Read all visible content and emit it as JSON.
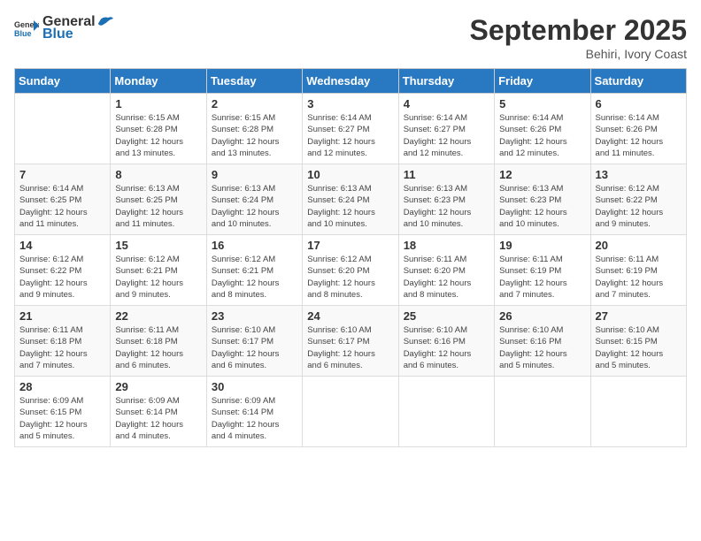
{
  "header": {
    "logo_general": "General",
    "logo_blue": "Blue",
    "month": "September 2025",
    "location": "Behiri, Ivory Coast"
  },
  "days_of_week": [
    "Sunday",
    "Monday",
    "Tuesday",
    "Wednesday",
    "Thursday",
    "Friday",
    "Saturday"
  ],
  "weeks": [
    [
      {
        "day": "",
        "info": ""
      },
      {
        "day": "1",
        "info": "Sunrise: 6:15 AM\nSunset: 6:28 PM\nDaylight: 12 hours\nand 13 minutes."
      },
      {
        "day": "2",
        "info": "Sunrise: 6:15 AM\nSunset: 6:28 PM\nDaylight: 12 hours\nand 13 minutes."
      },
      {
        "day": "3",
        "info": "Sunrise: 6:14 AM\nSunset: 6:27 PM\nDaylight: 12 hours\nand 12 minutes."
      },
      {
        "day": "4",
        "info": "Sunrise: 6:14 AM\nSunset: 6:27 PM\nDaylight: 12 hours\nand 12 minutes."
      },
      {
        "day": "5",
        "info": "Sunrise: 6:14 AM\nSunset: 6:26 PM\nDaylight: 12 hours\nand 12 minutes."
      },
      {
        "day": "6",
        "info": "Sunrise: 6:14 AM\nSunset: 6:26 PM\nDaylight: 12 hours\nand 11 minutes."
      }
    ],
    [
      {
        "day": "7",
        "info": "Sunrise: 6:14 AM\nSunset: 6:25 PM\nDaylight: 12 hours\nand 11 minutes."
      },
      {
        "day": "8",
        "info": "Sunrise: 6:13 AM\nSunset: 6:25 PM\nDaylight: 12 hours\nand 11 minutes."
      },
      {
        "day": "9",
        "info": "Sunrise: 6:13 AM\nSunset: 6:24 PM\nDaylight: 12 hours\nand 10 minutes."
      },
      {
        "day": "10",
        "info": "Sunrise: 6:13 AM\nSunset: 6:24 PM\nDaylight: 12 hours\nand 10 minutes."
      },
      {
        "day": "11",
        "info": "Sunrise: 6:13 AM\nSunset: 6:23 PM\nDaylight: 12 hours\nand 10 minutes."
      },
      {
        "day": "12",
        "info": "Sunrise: 6:13 AM\nSunset: 6:23 PM\nDaylight: 12 hours\nand 10 minutes."
      },
      {
        "day": "13",
        "info": "Sunrise: 6:12 AM\nSunset: 6:22 PM\nDaylight: 12 hours\nand 9 minutes."
      }
    ],
    [
      {
        "day": "14",
        "info": "Sunrise: 6:12 AM\nSunset: 6:22 PM\nDaylight: 12 hours\nand 9 minutes."
      },
      {
        "day": "15",
        "info": "Sunrise: 6:12 AM\nSunset: 6:21 PM\nDaylight: 12 hours\nand 9 minutes."
      },
      {
        "day": "16",
        "info": "Sunrise: 6:12 AM\nSunset: 6:21 PM\nDaylight: 12 hours\nand 8 minutes."
      },
      {
        "day": "17",
        "info": "Sunrise: 6:12 AM\nSunset: 6:20 PM\nDaylight: 12 hours\nand 8 minutes."
      },
      {
        "day": "18",
        "info": "Sunrise: 6:11 AM\nSunset: 6:20 PM\nDaylight: 12 hours\nand 8 minutes."
      },
      {
        "day": "19",
        "info": "Sunrise: 6:11 AM\nSunset: 6:19 PM\nDaylight: 12 hours\nand 7 minutes."
      },
      {
        "day": "20",
        "info": "Sunrise: 6:11 AM\nSunset: 6:19 PM\nDaylight: 12 hours\nand 7 minutes."
      }
    ],
    [
      {
        "day": "21",
        "info": "Sunrise: 6:11 AM\nSunset: 6:18 PM\nDaylight: 12 hours\nand 7 minutes."
      },
      {
        "day": "22",
        "info": "Sunrise: 6:11 AM\nSunset: 6:18 PM\nDaylight: 12 hours\nand 6 minutes."
      },
      {
        "day": "23",
        "info": "Sunrise: 6:10 AM\nSunset: 6:17 PM\nDaylight: 12 hours\nand 6 minutes."
      },
      {
        "day": "24",
        "info": "Sunrise: 6:10 AM\nSunset: 6:17 PM\nDaylight: 12 hours\nand 6 minutes."
      },
      {
        "day": "25",
        "info": "Sunrise: 6:10 AM\nSunset: 6:16 PM\nDaylight: 12 hours\nand 6 minutes."
      },
      {
        "day": "26",
        "info": "Sunrise: 6:10 AM\nSunset: 6:16 PM\nDaylight: 12 hours\nand 5 minutes."
      },
      {
        "day": "27",
        "info": "Sunrise: 6:10 AM\nSunset: 6:15 PM\nDaylight: 12 hours\nand 5 minutes."
      }
    ],
    [
      {
        "day": "28",
        "info": "Sunrise: 6:09 AM\nSunset: 6:15 PM\nDaylight: 12 hours\nand 5 minutes."
      },
      {
        "day": "29",
        "info": "Sunrise: 6:09 AM\nSunset: 6:14 PM\nDaylight: 12 hours\nand 4 minutes."
      },
      {
        "day": "30",
        "info": "Sunrise: 6:09 AM\nSunset: 6:14 PM\nDaylight: 12 hours\nand 4 minutes."
      },
      {
        "day": "",
        "info": ""
      },
      {
        "day": "",
        "info": ""
      },
      {
        "day": "",
        "info": ""
      },
      {
        "day": "",
        "info": ""
      }
    ]
  ]
}
